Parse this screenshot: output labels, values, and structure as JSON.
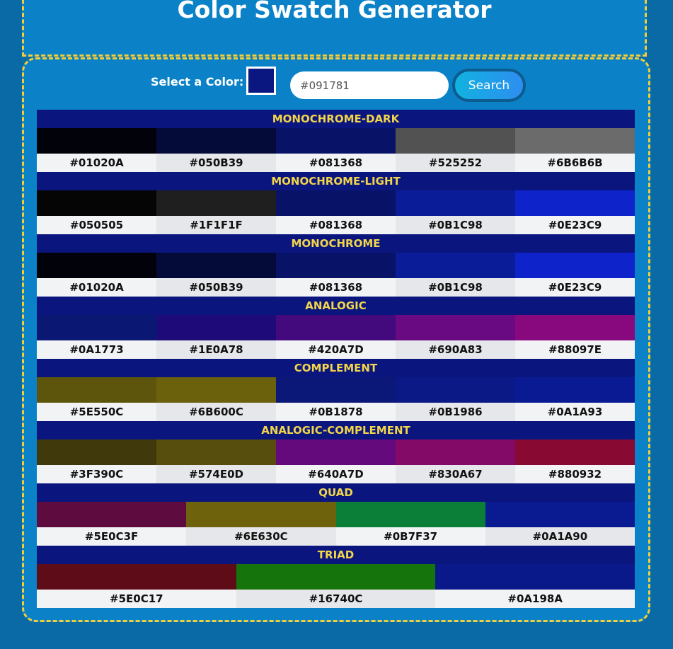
{
  "title": "Color Swatch Generator",
  "controls": {
    "label": "Select a Color:",
    "current_color": "#0a1780",
    "hex_value": "#091781",
    "search_label": "Search"
  },
  "schemes": [
    {
      "name": "MONOCHROME-DARK",
      "colors": [
        "#01020A",
        "#050B39",
        "#081368",
        "#525252",
        "#6B6B6B"
      ]
    },
    {
      "name": "MONOCHROME-LIGHT",
      "colors": [
        "#050505",
        "#1F1F1F",
        "#081368",
        "#0B1C98",
        "#0E23C9"
      ]
    },
    {
      "name": "MONOCHROME",
      "colors": [
        "#01020A",
        "#050B39",
        "#081368",
        "#0B1C98",
        "#0E23C9"
      ]
    },
    {
      "name": "ANALOGIC",
      "colors": [
        "#0A1773",
        "#1E0A78",
        "#420A7D",
        "#690A83",
        "#88097E"
      ]
    },
    {
      "name": "COMPLEMENT",
      "colors": [
        "#5E550C",
        "#6B600C",
        "#0B1878",
        "#0B1986",
        "#0A1A93"
      ]
    },
    {
      "name": "ANALOGIC-COMPLEMENT",
      "colors": [
        "#3F390C",
        "#574E0D",
        "#640A7D",
        "#830A67",
        "#880932"
      ]
    },
    {
      "name": "QUAD",
      "colors": [
        "#5E0C3F",
        "#6E630C",
        "#0B7F37",
        "#0A1A90"
      ]
    },
    {
      "name": "TRIAD",
      "colors": [
        "#5E0C17",
        "#16740C",
        "#0A198A"
      ]
    }
  ]
}
